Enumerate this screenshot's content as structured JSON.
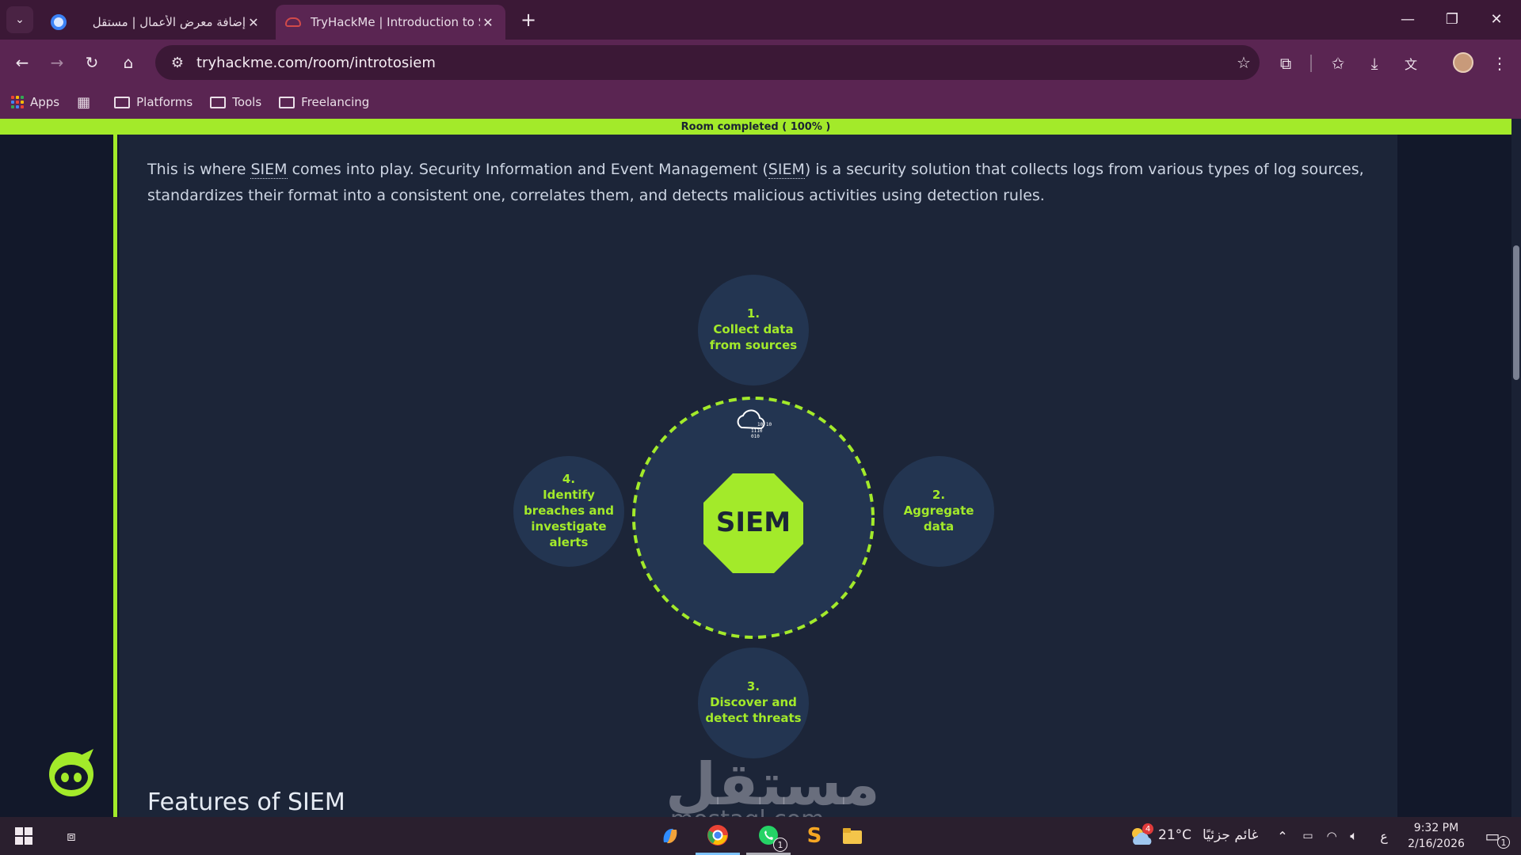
{
  "browser": {
    "tabs": [
      {
        "title": "إضافة معرض الأعمال | مستقل",
        "active": false,
        "favicon_color": "#3b82f6"
      },
      {
        "title": "TryHackMe | Introduction to SIEM",
        "active": true,
        "favicon_color": "#d14a4a"
      }
    ],
    "new_tab_label": "+",
    "url": "tryhackme.com/room/introtosiem",
    "bookmarks": [
      {
        "label": "Apps",
        "icon": "apps-grid-icon"
      },
      {
        "label": "",
        "icon": "tab-groups-icon"
      },
      {
        "label": "Platforms",
        "icon": "folder-icon"
      },
      {
        "label": "Tools",
        "icon": "folder-icon"
      },
      {
        "label": "Freelancing",
        "icon": "folder-icon"
      }
    ]
  },
  "room": {
    "progress_text": "Room completed ( 100% )",
    "progress_color": "#a3ea2a",
    "paragraph": {
      "p1": "This is where ",
      "abbr1": "SIEM",
      "p2": " comes into play. Security Information and Event Management (",
      "abbr2": "SIEM",
      "p3": ") is a security solution that collects logs from various types of log sources, standardizes their format into a consistent one, correlates them, and detects malicious activities using detection rules."
    },
    "diagram": {
      "center_label": "SIEM",
      "cloud_bits": "10 10 1110 010",
      "nodes": [
        {
          "lines": [
            "1.",
            "Collect data",
            "from sources"
          ]
        },
        {
          "lines": [
            "2.",
            "Aggregate",
            "data"
          ]
        },
        {
          "lines": [
            "3.",
            "Discover and",
            "detect threats"
          ]
        },
        {
          "lines": [
            "4.",
            "Identify",
            "breaches and",
            "investigate",
            "alerts"
          ]
        }
      ]
    },
    "next_section_title": "Features of SIEM"
  },
  "watermark": {
    "main": "مستقل",
    "sub": "mostaql.com"
  },
  "taskbar": {
    "weather_temp": "21°C",
    "weather_desc": "غائم جزئيًا",
    "weather_badge": "4",
    "language": "ع",
    "time": "9:32 PM",
    "date": "2/16/2026",
    "notification_count": "1",
    "whatsapp_badge": "1"
  },
  "colors": {
    "accent_green": "#a3ea2a",
    "card_bg": "#1c2538",
    "node_bg": "#233551",
    "tab_bar": "#3b1836",
    "toolbar": "#5a2552"
  }
}
